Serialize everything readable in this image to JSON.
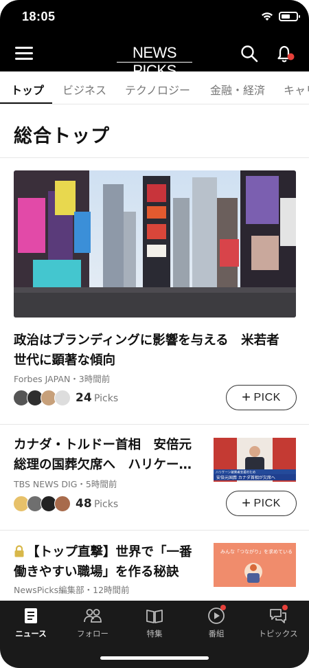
{
  "status_bar": {
    "time": "18:05"
  },
  "header": {
    "logo": "NEWS PICKS"
  },
  "tabs": [
    {
      "label": "トップ",
      "active": true
    },
    {
      "label": "ビジネス"
    },
    {
      "label": "テクノロジー"
    },
    {
      "label": "金融・経済"
    },
    {
      "label": "キャリ"
    }
  ],
  "section_title": "総合トップ",
  "articles": [
    {
      "headline_line1": "政治はブランディングに影響を与える　米若者",
      "headline_line2": "世代に顕著な傾向",
      "meta": "Forbes JAPAN・3時間前",
      "picks_count": "24",
      "picks_label": "Picks",
      "pick_button": "PICK"
    },
    {
      "headline_line1": "カナダ・トルドー首相　安倍元",
      "headline_line2": "総理の国葬欠席へ　ハリケー…",
      "meta": "TBS NEWS DIG・5時間前",
      "picks_count": "48",
      "picks_label": "Picks",
      "pick_button": "PICK",
      "thumb_caption_top": "ハリケーン被害者支援のため",
      "thumb_caption": "安倍元国葬 カナダ首相が欠席へ"
    },
    {
      "headline_line1": "【トップ直撃】世界で「一番",
      "headline_line2": "働きやすい職場」を作る秘訣",
      "meta": "NewsPicks編集部・12時間前",
      "thumb_caption": "みんな「つながり」を求めている"
    }
  ],
  "tabbar": [
    {
      "label": "ニュース",
      "icon": "news-icon",
      "active": true
    },
    {
      "label": "フォロー",
      "icon": "follow-icon"
    },
    {
      "label": "特集",
      "icon": "book-icon"
    },
    {
      "label": "番組",
      "icon": "play-icon"
    },
    {
      "label": "トピックス",
      "icon": "chat-icon"
    }
  ],
  "colors": {
    "accent": "#e6403a",
    "header_bg": "#000000",
    "tabbar_bg": "#1a1a1a",
    "lock": "#d8b84a"
  }
}
